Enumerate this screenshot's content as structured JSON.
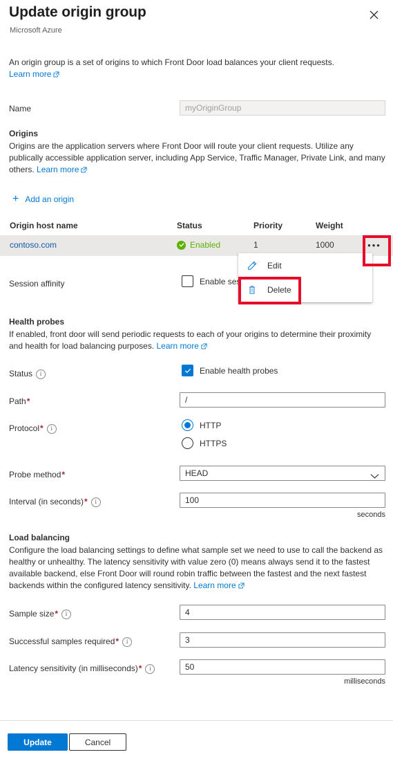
{
  "header": {
    "title": "Update origin group",
    "subtitle": "Microsoft Azure",
    "close_icon": "close-icon"
  },
  "intro": {
    "text": "An origin group is a set of origins to which Front Door load balances your client requests.",
    "learn_more": "Learn more"
  },
  "name_field": {
    "label": "Name",
    "value": "myOriginGroup",
    "disabled": true
  },
  "origins": {
    "heading": "Origins",
    "description": "Origins are the application servers where Front Door will route your client requests. Utilize any publically accessible application server, including App Service, Traffic Manager, Private Link, and many others.",
    "learn_more": "Learn more",
    "add_label": "Add an origin",
    "columns": [
      "Origin host name",
      "Status",
      "Priority",
      "Weight"
    ],
    "rows": [
      {
        "host": "contoso.com",
        "status": "Enabled",
        "priority": "1",
        "weight": "1000",
        "more_label": "•••"
      }
    ],
    "context_menu": {
      "items": [
        {
          "label": "Edit",
          "icon": "pencil-icon"
        },
        {
          "label": "Delete",
          "icon": "trash-icon"
        }
      ],
      "highlight_color": "#e60e2b"
    }
  },
  "session_affinity": {
    "label": "Session affinity",
    "checkbox_label": "Enable session affinity",
    "checked": false
  },
  "health_probes": {
    "heading": "Health probes",
    "description": "If enabled, front door will send periodic requests to each of your origins to determine their proximity and health for load balancing purposes.",
    "learn_more": "Learn more",
    "status_label": "Status",
    "status_checkbox_label": "Enable health probes",
    "status_checked": true,
    "path_label": "Path",
    "path_value": "/",
    "protocol_label": "Protocol",
    "protocol_options": [
      "HTTP",
      "HTTPS"
    ],
    "protocol_selected": "HTTP",
    "probe_method_label": "Probe method",
    "probe_method_value": "HEAD",
    "interval_label": "Interval (in seconds)",
    "interval_value": "100",
    "interval_unit": "seconds"
  },
  "load_balancing": {
    "heading": "Load balancing",
    "description": "Configure the load balancing settings to define what sample set we need to use to call the backend as healthy or unhealthy. The latency sensitivity with value zero (0) means always send it to the fastest available backend, else Front Door will round robin traffic between the fastest and the next fastest backends within the configured latency sensitivity.",
    "learn_more": "Learn more",
    "sample_size_label": "Sample size",
    "sample_size_value": "4",
    "successful_samples_label": "Successful samples required",
    "successful_samples_value": "3",
    "latency_label": "Latency sensitivity (in milliseconds)",
    "latency_value": "50",
    "latency_unit": "milliseconds"
  },
  "footer": {
    "primary": "Update",
    "secondary": "Cancel"
  },
  "colors": {
    "accent": "#0078d4",
    "success": "#5bb300",
    "required": "#a4262c",
    "highlight": "#e60e2b"
  }
}
